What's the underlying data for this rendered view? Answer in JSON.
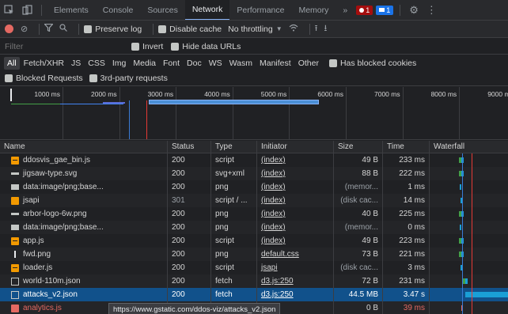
{
  "tabbar": {
    "tabs": [
      "Elements",
      "Console",
      "Sources",
      "Network",
      "Performance",
      "Memory"
    ],
    "active": "Network",
    "more": "»",
    "error_count": "1",
    "message_count": "1"
  },
  "toolbar": {
    "preserve_log": "Preserve log",
    "disable_cache": "Disable cache",
    "throttling": "No throttling"
  },
  "filter": {
    "placeholder": "Filter",
    "invert": "Invert",
    "hide_data_urls": "Hide data URLs"
  },
  "types": [
    "All",
    "Fetch/XHR",
    "JS",
    "CSS",
    "Img",
    "Media",
    "Font",
    "Doc",
    "WS",
    "Wasm",
    "Manifest",
    "Other"
  ],
  "has_blocked_cookies": "Has blocked cookies",
  "blocked_requests": "Blocked Requests",
  "third_party": "3rd-party requests",
  "overview_ticks": [
    "1000 ms",
    "2000 ms",
    "3000 ms",
    "4000 ms",
    "5000 ms",
    "6000 ms",
    "7000 ms",
    "8000 ms",
    "9000 ms"
  ],
  "columns": {
    "name": "Name",
    "status": "Status",
    "type": "Type",
    "initiator": "Initiator",
    "size": "Size",
    "time": "Time",
    "waterfall": "Waterfall"
  },
  "requests": [
    {
      "name": "ddosvis_gae_bin.js",
      "icon": "js-file-icon",
      "status": "200",
      "type": "script",
      "initiator": "(index)",
      "size": "49 B",
      "time": "233 ms",
      "wf_start": 0.4,
      "wf_len": 0.03
    },
    {
      "name": "jigsaw-type.svg",
      "icon": "svg-file-icon",
      "status": "200",
      "type": "svg+xml",
      "initiator": "(index)",
      "size": "88 B",
      "time": "222 ms",
      "wf_start": 0.4,
      "wf_len": 0.03
    },
    {
      "name": "data:image/png;base...",
      "icon": "image-file-icon",
      "status": "200",
      "type": "png",
      "initiator": "(index)",
      "size": "(memor...",
      "time": "1 ms",
      "wf_start": 0.38,
      "wf_len": 0.01
    },
    {
      "name": "jsapi",
      "icon": "jsapi-file-icon",
      "status": "301",
      "type": "script / ...",
      "initiator": "(index)",
      "size": "(disk cac...",
      "time": "14 ms",
      "wf_start": 0.39,
      "wf_len": 0.01
    },
    {
      "name": "arbor-logo-6w.png",
      "icon": "svg-file-icon",
      "status": "200",
      "type": "png",
      "initiator": "(index)",
      "size": "40 B",
      "time": "225 ms",
      "wf_start": 0.4,
      "wf_len": 0.03
    },
    {
      "name": "data:image/png;base...",
      "icon": "image-file-icon",
      "status": "200",
      "type": "png",
      "initiator": "(index)",
      "size": "(memor...",
      "time": "0 ms",
      "wf_start": 0.38,
      "wf_len": 0.01
    },
    {
      "name": "app.js",
      "icon": "js-file-icon",
      "status": "200",
      "type": "script",
      "initiator": "(index)",
      "size": "49 B",
      "time": "223 ms",
      "wf_start": 0.4,
      "wf_len": 0.03
    },
    {
      "name": "fwd.png",
      "icon": "line-file-icon",
      "status": "200",
      "type": "png",
      "initiator": "default.css",
      "size": "73 B",
      "time": "221 ms",
      "wf_start": 0.4,
      "wf_len": 0.03
    },
    {
      "name": "loader.js",
      "icon": "js-file-icon",
      "status": "200",
      "type": "script",
      "initiator": "jsapi",
      "size": "(disk cac...",
      "time": "3 ms",
      "wf_start": 0.39,
      "wf_len": 0.01
    },
    {
      "name": "world-110m.json",
      "icon": "document-file-icon",
      "status": "200",
      "type": "fetch",
      "initiator": "d3.js:250",
      "size": "72 B",
      "time": "231 ms",
      "wf_start": 0.45,
      "wf_len": 0.03
    },
    {
      "name": "attacks_v2.json",
      "icon": "document-file-icon",
      "status": "200",
      "type": "fetch",
      "initiator": "d3.js:250",
      "size": "44.5 MB",
      "time": "3.47 s",
      "wf_start": 0.45,
      "wf_len": 0.55,
      "selected": true
    },
    {
      "name": "analytics.js",
      "icon": "error-file-icon",
      "status": "",
      "type": "",
      "initiator": "",
      "size": "0 B",
      "time": "39 ms",
      "error": true,
      "wf_start": 0.4,
      "wf_len": 0.01
    }
  ],
  "tooltip": "https://www.gstatic.com/ddos-viz/attacks_v2.json",
  "colors": {
    "waterfall_wait": "#43a047",
    "waterfall_download": "#1a9fd6",
    "selection": "#11518b",
    "error": "#e46962"
  }
}
